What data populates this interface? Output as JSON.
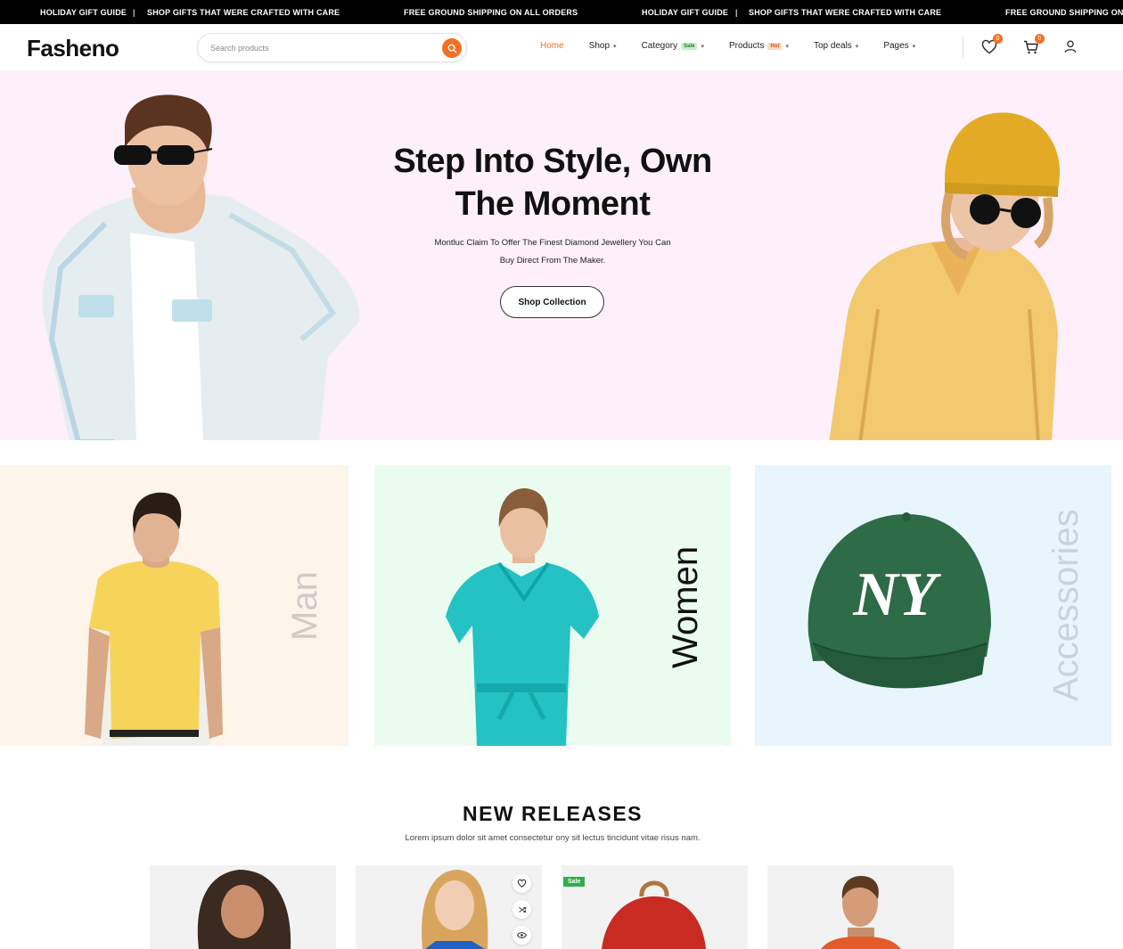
{
  "topbar": {
    "items": [
      {
        "text": "HOLIDAY GIFT GUIDE"
      },
      {
        "text": "SHOP GIFTS THAT WERE CRAFTED WITH CARE"
      },
      {
        "text": "FREE GROUND SHIPPING ON ALL ORDERS"
      },
      {
        "text": "HOLIDAY GIFT GUIDE"
      },
      {
        "text": "SHOP GIFTS THAT WERE CRAFTED WITH CARE"
      },
      {
        "text": "FREE GROUND SHIPPING ON AL"
      }
    ],
    "separator": "|"
  },
  "header": {
    "logo": "Fasheno",
    "search_placeholder": "Search products",
    "nav": [
      {
        "label": "Home",
        "active": true
      },
      {
        "label": "Shop",
        "caret": true
      },
      {
        "label": "Category",
        "pill": "Sale",
        "caret": true
      },
      {
        "label": "Products",
        "pill": "Hot",
        "caret": true
      },
      {
        "label": "Top deals",
        "caret": true
      },
      {
        "label": "Pages",
        "caret": true
      }
    ],
    "wishlist_count": "0",
    "cart_count": "0",
    "icons": [
      "heart-icon",
      "cart-icon",
      "user-icon",
      "search-icon"
    ]
  },
  "hero": {
    "title_line1": "Step Into Style, Own",
    "title_line2": "The Moment",
    "subtitle_line1": "Montluc Claim To Offer The Finest Diamond Jewellery You Can",
    "subtitle_line2": "Buy Direct From The Maker.",
    "cta": "Shop Collection"
  },
  "categories": [
    {
      "label": "Man"
    },
    {
      "label": "Women"
    },
    {
      "label": "Accessories"
    }
  ],
  "new_releases": {
    "title": "NEW RELEASES",
    "subtitle": "Lorem ipsum dolor sit amet consectetur ony sit lectus tincidunt vitae risus nam.",
    "sale_tag": "Sale"
  },
  "colors": {
    "accent": "#f36f21",
    "hero_bg": "#fdf0fa",
    "man_bg": "#fdf4ea",
    "women_bg": "#eafcf0",
    "accessories_bg": "#e9f5fd",
    "sale_green": "#2fae4b"
  }
}
